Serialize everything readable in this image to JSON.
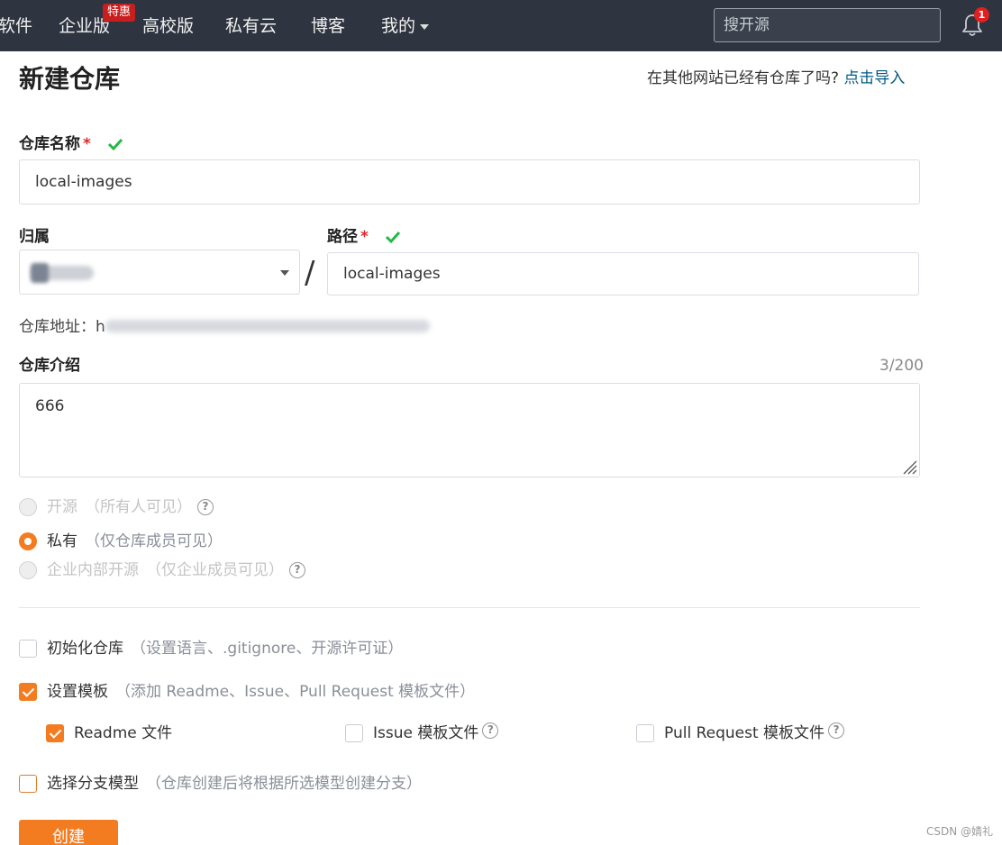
{
  "nav": {
    "items": [
      "软件",
      "企业版",
      "高校版",
      "私有云",
      "博客"
    ],
    "badge": "特惠",
    "mine": "我的",
    "search_placeholder": "搜开源",
    "notification_count": "1"
  },
  "header": {
    "title": "新建仓库",
    "import_prompt": "在其他网站已经有仓库了吗?",
    "import_link": "点击导入"
  },
  "form": {
    "repo_name_label": "仓库名称",
    "repo_name_value": "local-images",
    "owner_label": "归属",
    "path_label": "路径",
    "path_value": "local-images",
    "slash": "/",
    "required_mark": "*",
    "address_label": "仓库地址：",
    "address_prefix": "h",
    "intro_label": "仓库介绍",
    "intro_counter": "3/200",
    "intro_value": "666"
  },
  "visibility": [
    {
      "label": "开源",
      "hint": "（所有人可见）",
      "selected": false,
      "disabled": true,
      "help": "?"
    },
    {
      "label": "私有",
      "hint": "（仅仓库成员可见）",
      "selected": true,
      "disabled": false
    },
    {
      "label": "企业内部开源",
      "hint": "（仅企业成员可见）",
      "selected": false,
      "disabled": true,
      "help": "?"
    }
  ],
  "options": {
    "init": {
      "label": "初始化仓库",
      "hint": "（设置语言、.gitignore、开源许可证）",
      "checked": false
    },
    "template": {
      "label": "设置模板",
      "hint": "（添加 Readme、Issue、Pull Request 模板文件）",
      "checked": true
    },
    "readme": {
      "label": "Readme 文件",
      "checked": true
    },
    "issue": {
      "label": "Issue 模板文件",
      "checked": false,
      "help": "?"
    },
    "pr": {
      "label": "Pull Request 模板文件",
      "checked": false,
      "help": "?"
    },
    "branch": {
      "label": "选择分支模型",
      "hint": "（仓库创建后将根据所选模型创建分支）",
      "checked": false
    }
  },
  "submit_label": "创建",
  "watermark": "CSDN @婧礼",
  "colors": {
    "accent": "#f47c20",
    "nav_bg": "#2e3440",
    "link": "#005980",
    "success": "#21ba45",
    "required": "#db2828"
  }
}
